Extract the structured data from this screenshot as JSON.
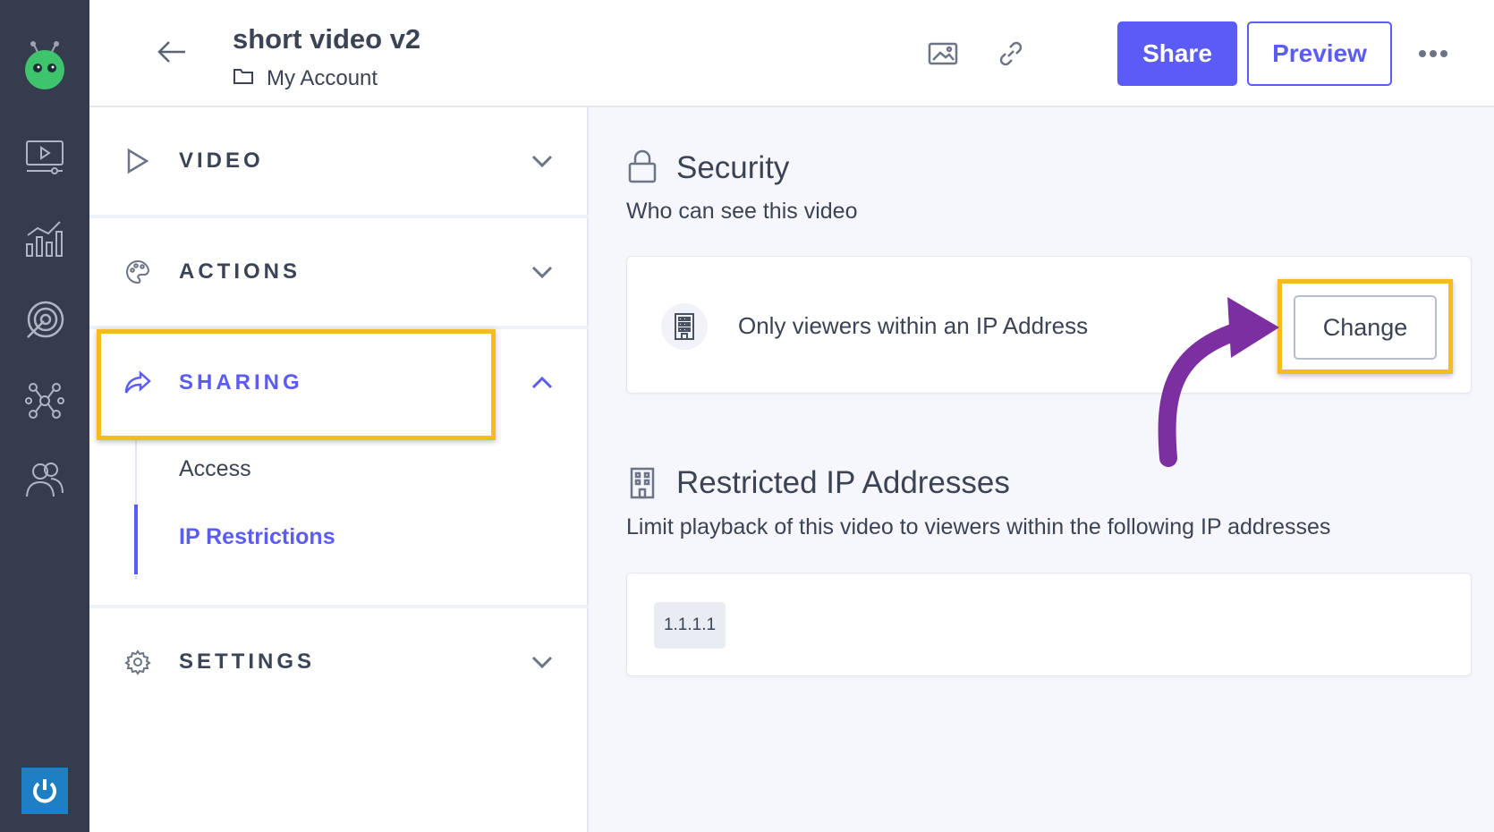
{
  "header": {
    "title": "short video v2",
    "breadcrumb": "My Account",
    "share_label": "Share",
    "preview_label": "Preview"
  },
  "sidebar": {
    "sections": [
      {
        "label": "VIDEO",
        "icon": "play-outline-icon",
        "expanded": false
      },
      {
        "label": "ACTIONS",
        "icon": "palette-icon",
        "expanded": false
      },
      {
        "label": "SHARING",
        "icon": "share-arrow-icon",
        "expanded": true
      },
      {
        "label": "SETTINGS",
        "icon": "gear-icon",
        "expanded": false
      }
    ],
    "sharing_items": [
      {
        "label": "Access",
        "active": false
      },
      {
        "label": "IP Restrictions",
        "active": true
      }
    ]
  },
  "security": {
    "title": "Security",
    "subtitle": "Who can see this video",
    "option_label": "Only viewers within an IP Address",
    "change_label": "Change"
  },
  "restricted": {
    "title": "Restricted IP Addresses",
    "subtitle": "Limit playback of this video to viewers within the following IP addresses",
    "ips": [
      "1.1.1.1"
    ]
  },
  "colors": {
    "accent": "#5b5cf5",
    "rail": "#353c4e",
    "highlight": "#f3be1c",
    "annotation_arrow": "#7b2fa0"
  }
}
